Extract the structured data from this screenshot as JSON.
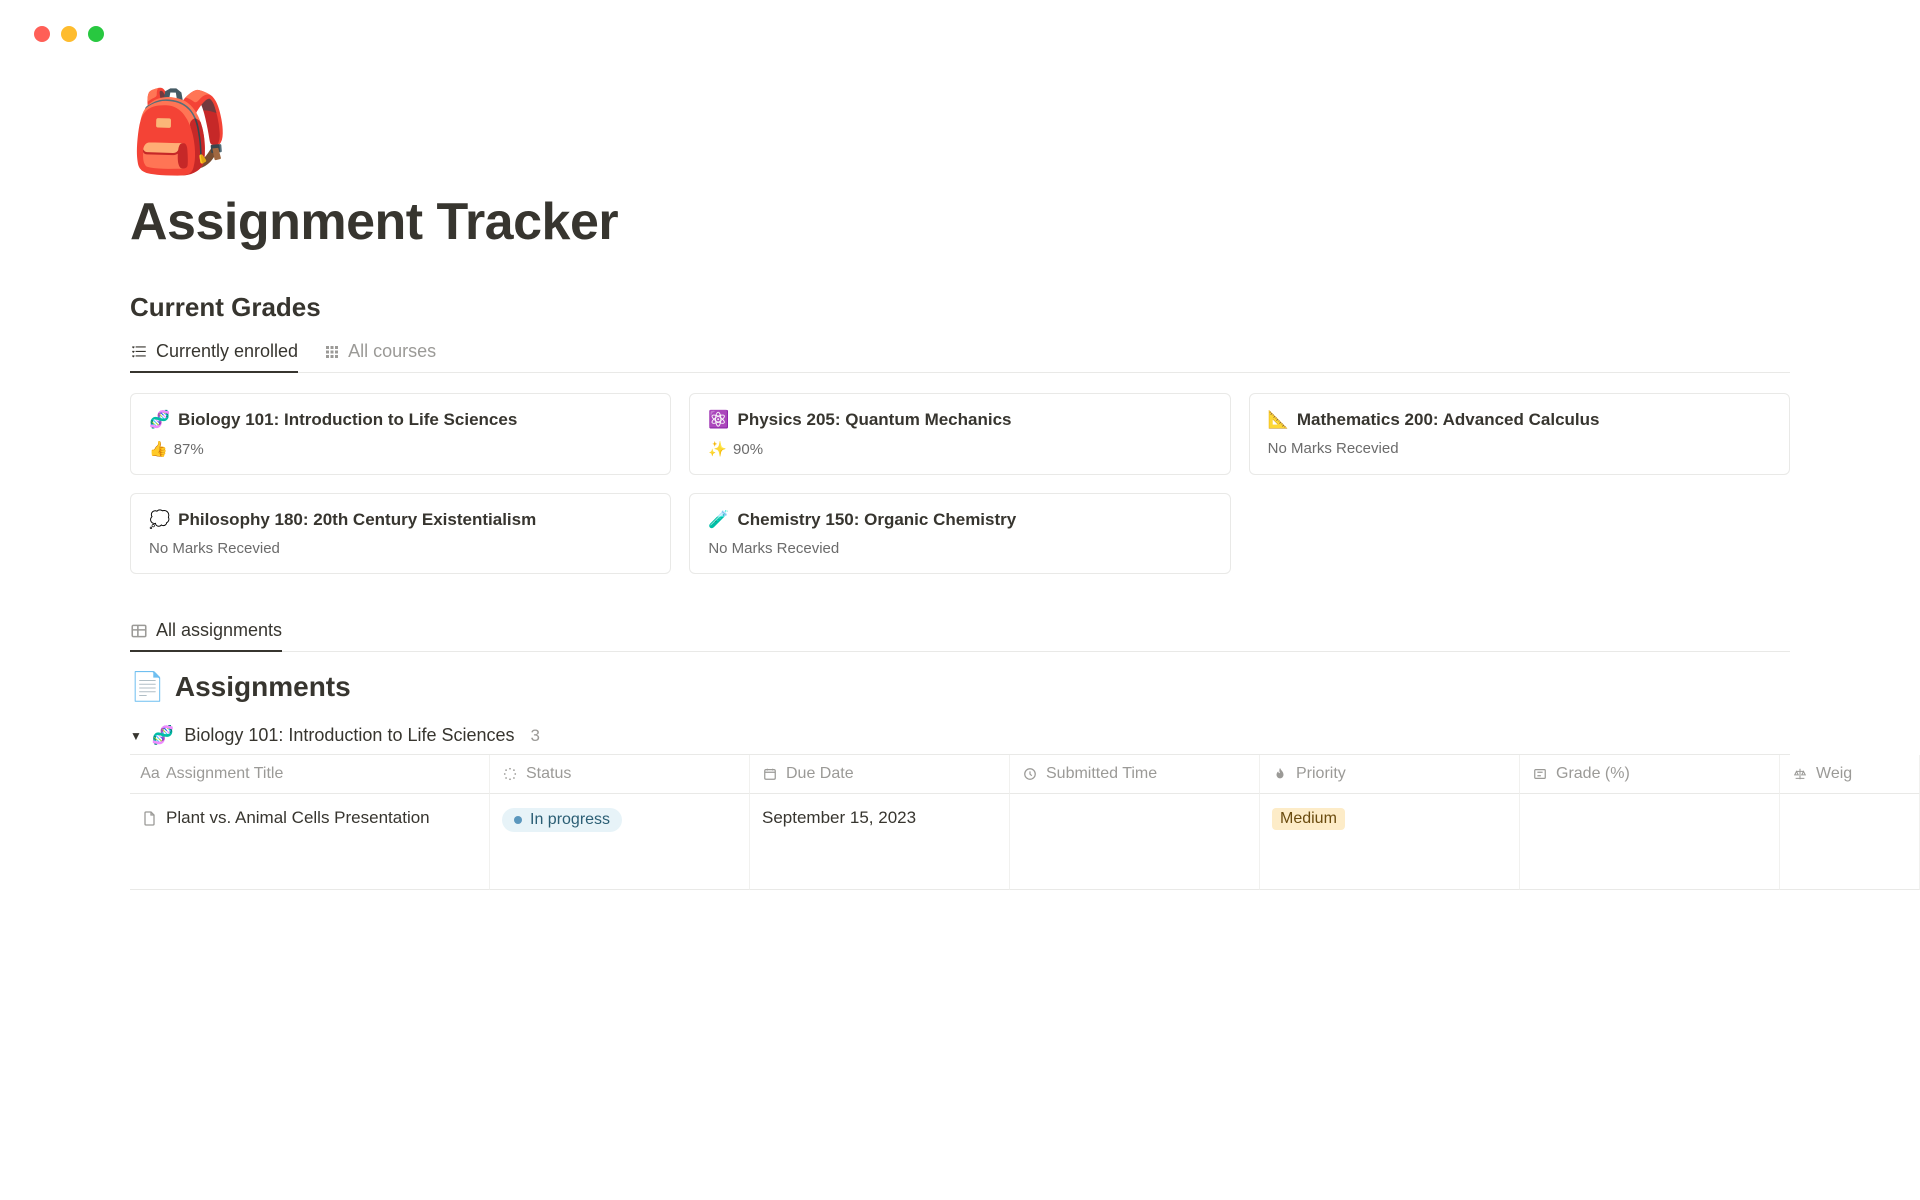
{
  "page": {
    "icon": "🎒",
    "title": "Assignment Tracker"
  },
  "grades_section": {
    "heading": "Current Grades",
    "tabs": [
      {
        "label": "Currently enrolled",
        "active": true
      },
      {
        "label": "All courses",
        "active": false
      }
    ],
    "courses": [
      {
        "icon": "🧬",
        "name": "Biology 101: Introduction to Life Sciences",
        "grade_icon": "👍",
        "grade": "87%"
      },
      {
        "icon": "⚛️",
        "name": "Physics 205: Quantum Mechanics",
        "grade_icon": "✨",
        "grade": "90%"
      },
      {
        "icon": "📐",
        "name": "Mathematics 200: Advanced Calculus",
        "grade_icon": "",
        "grade": "No Marks Recevied"
      },
      {
        "icon": "💭",
        "name": "Philosophy 180: 20th Century Existentialism",
        "grade_icon": "",
        "grade": "No Marks Recevied"
      },
      {
        "icon": "🧪",
        "name": "Chemistry 150: Organic Chemistry",
        "grade_icon": "",
        "grade": "No Marks Recevied"
      }
    ]
  },
  "assignments_section": {
    "tab_label": "All assignments",
    "heading_icon": "📄",
    "heading": "Assignments",
    "group": {
      "icon": "🧬",
      "name": "Biology 101: Introduction to Life Sciences",
      "count": "3"
    },
    "columns": [
      "Assignment Title",
      "Status",
      "Due Date",
      "Submitted Time",
      "Priority",
      "Grade (%)",
      "Weig"
    ],
    "rows": [
      {
        "title": "Plant vs. Animal Cells Presentation",
        "status": "In progress",
        "due_date": "September 15, 2023",
        "submitted_time": "",
        "priority": "Medium",
        "grade": "",
        "weight": ""
      }
    ]
  }
}
